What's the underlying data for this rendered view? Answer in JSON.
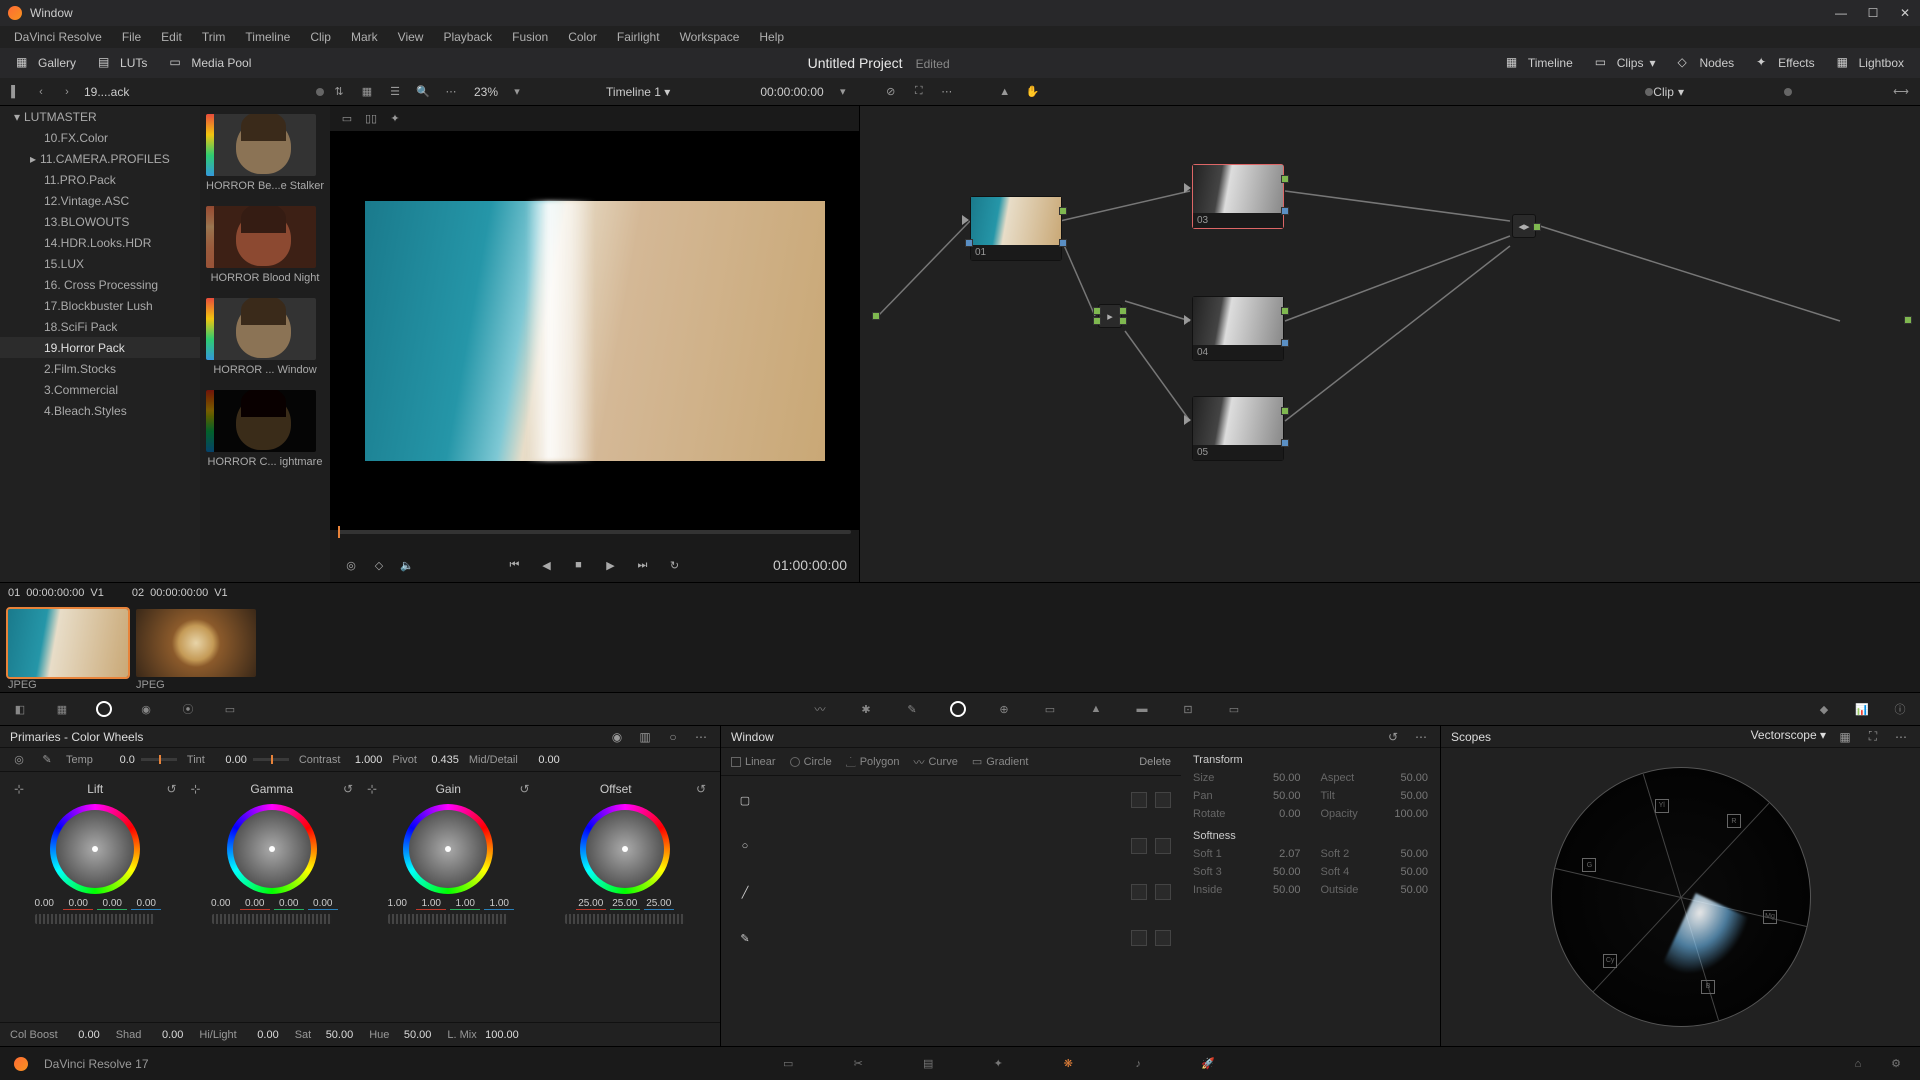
{
  "window": {
    "title": "Window",
    "tools": {
      "linear": "Linear",
      "circle": "Circle",
      "polygon": "Polygon",
      "curve": "Curve",
      "gradient": "Gradient",
      "delete": "Delete"
    },
    "transform": {
      "title": "Transform",
      "size_l": "Size",
      "size_v": "50.00",
      "aspect_l": "Aspect",
      "aspect_v": "50.00",
      "pan_l": "Pan",
      "pan_v": "50.00",
      "tilt_l": "Tilt",
      "tilt_v": "50.00",
      "rotate_l": "Rotate",
      "rotate_v": "0.00",
      "opacity_l": "Opacity",
      "opacity_v": "100.00"
    },
    "softness": {
      "title": "Softness",
      "s1_l": "Soft 1",
      "s1_v": "2.07",
      "s2_l": "Soft 2",
      "s2_v": "50.00",
      "s3_l": "Soft 3",
      "s3_v": "50.00",
      "s4_l": "Soft 4",
      "s4_v": "50.00",
      "in_l": "Inside",
      "in_v": "50.00",
      "out_l": "Outside",
      "out_v": "50.00"
    }
  },
  "menubar": [
    "DaVinci Resolve",
    "File",
    "Edit",
    "Trim",
    "Timeline",
    "Clip",
    "Mark",
    "View",
    "Playback",
    "Fusion",
    "Color",
    "Fairlight",
    "Workspace",
    "Help"
  ],
  "topbar": {
    "gallery": "Gallery",
    "luts": "LUTs",
    "mediapool": "Media Pool",
    "project": "Untitled Project",
    "status": "Edited",
    "timeline_btn": "Timeline",
    "clips_btn": "Clips",
    "nodes_btn": "Nodes",
    "effects_btn": "Effects",
    "lightbox_btn": "Lightbox"
  },
  "subbar": {
    "crumb": "19....ack",
    "zoom": "23%",
    "timeline": "Timeline 1",
    "tc": "00:00:00:00",
    "clip_mode": "Clip"
  },
  "lut_tree": {
    "root": "LUTMASTER",
    "items": [
      "10.FX.Color",
      "11.CAMERA.PROFILES",
      "11.PRO.Pack",
      "12.Vintage.ASC",
      "13.BLOWOUTS",
      "14.HDR.Looks.HDR",
      "15.LUX",
      "16. Cross Processing",
      "17.Blockbuster Lush",
      "18.SciFi Pack",
      "19.Horror Pack",
      "2.Film.Stocks",
      "3.Commercial",
      "4.Bleach.Styles"
    ],
    "selected": "19.Horror Pack"
  },
  "lut_thumbs": [
    "HORROR Be...e Stalker",
    "HORROR Blood Night",
    "HORROR ... Window",
    "HORROR C... ightmare"
  ],
  "viewer": {
    "tc": "01:00:00:00"
  },
  "nodes": {
    "n1": "01",
    "n3": "03",
    "n4": "04",
    "n5": "05"
  },
  "clipstrip": {
    "header": [
      [
        "01",
        "00:00:00:00",
        "V1"
      ],
      [
        "02",
        "00:00:00:00",
        "V1"
      ]
    ],
    "labels": [
      "JPEG",
      "JPEG"
    ]
  },
  "primaries": {
    "title": "Primaries - Color Wheels",
    "row1": {
      "temp_l": "Temp",
      "temp_v": "0.0",
      "tint_l": "Tint",
      "tint_v": "0.00",
      "contrast_l": "Contrast",
      "contrast_v": "1.000",
      "pivot_l": "Pivot",
      "pivot_v": "0.435",
      "md_l": "Mid/Detail",
      "md_v": "0.00"
    },
    "wheels": {
      "lift": {
        "label": "Lift",
        "vals": [
          "0.00",
          "0.00",
          "0.00",
          "0.00"
        ]
      },
      "gamma": {
        "label": "Gamma",
        "vals": [
          "0.00",
          "0.00",
          "0.00",
          "0.00"
        ]
      },
      "gain": {
        "label": "Gain",
        "vals": [
          "1.00",
          "1.00",
          "1.00",
          "1.00"
        ]
      },
      "offset": {
        "label": "Offset",
        "vals": [
          "25.00",
          "25.00",
          "25.00"
        ]
      }
    },
    "row2": {
      "cb_l": "Col Boost",
      "cb_v": "0.00",
      "shad_l": "Shad",
      "shad_v": "0.00",
      "hl_l": "Hi/Light",
      "hl_v": "0.00",
      "sat_l": "Sat",
      "sat_v": "50.00",
      "hue_l": "Hue",
      "hue_v": "50.00",
      "lm_l": "L. Mix",
      "lm_v": "100.00"
    }
  },
  "scopes": {
    "title": "Scopes",
    "mode": "Vectorscope"
  },
  "footer": {
    "app": "DaVinci Resolve 17"
  }
}
